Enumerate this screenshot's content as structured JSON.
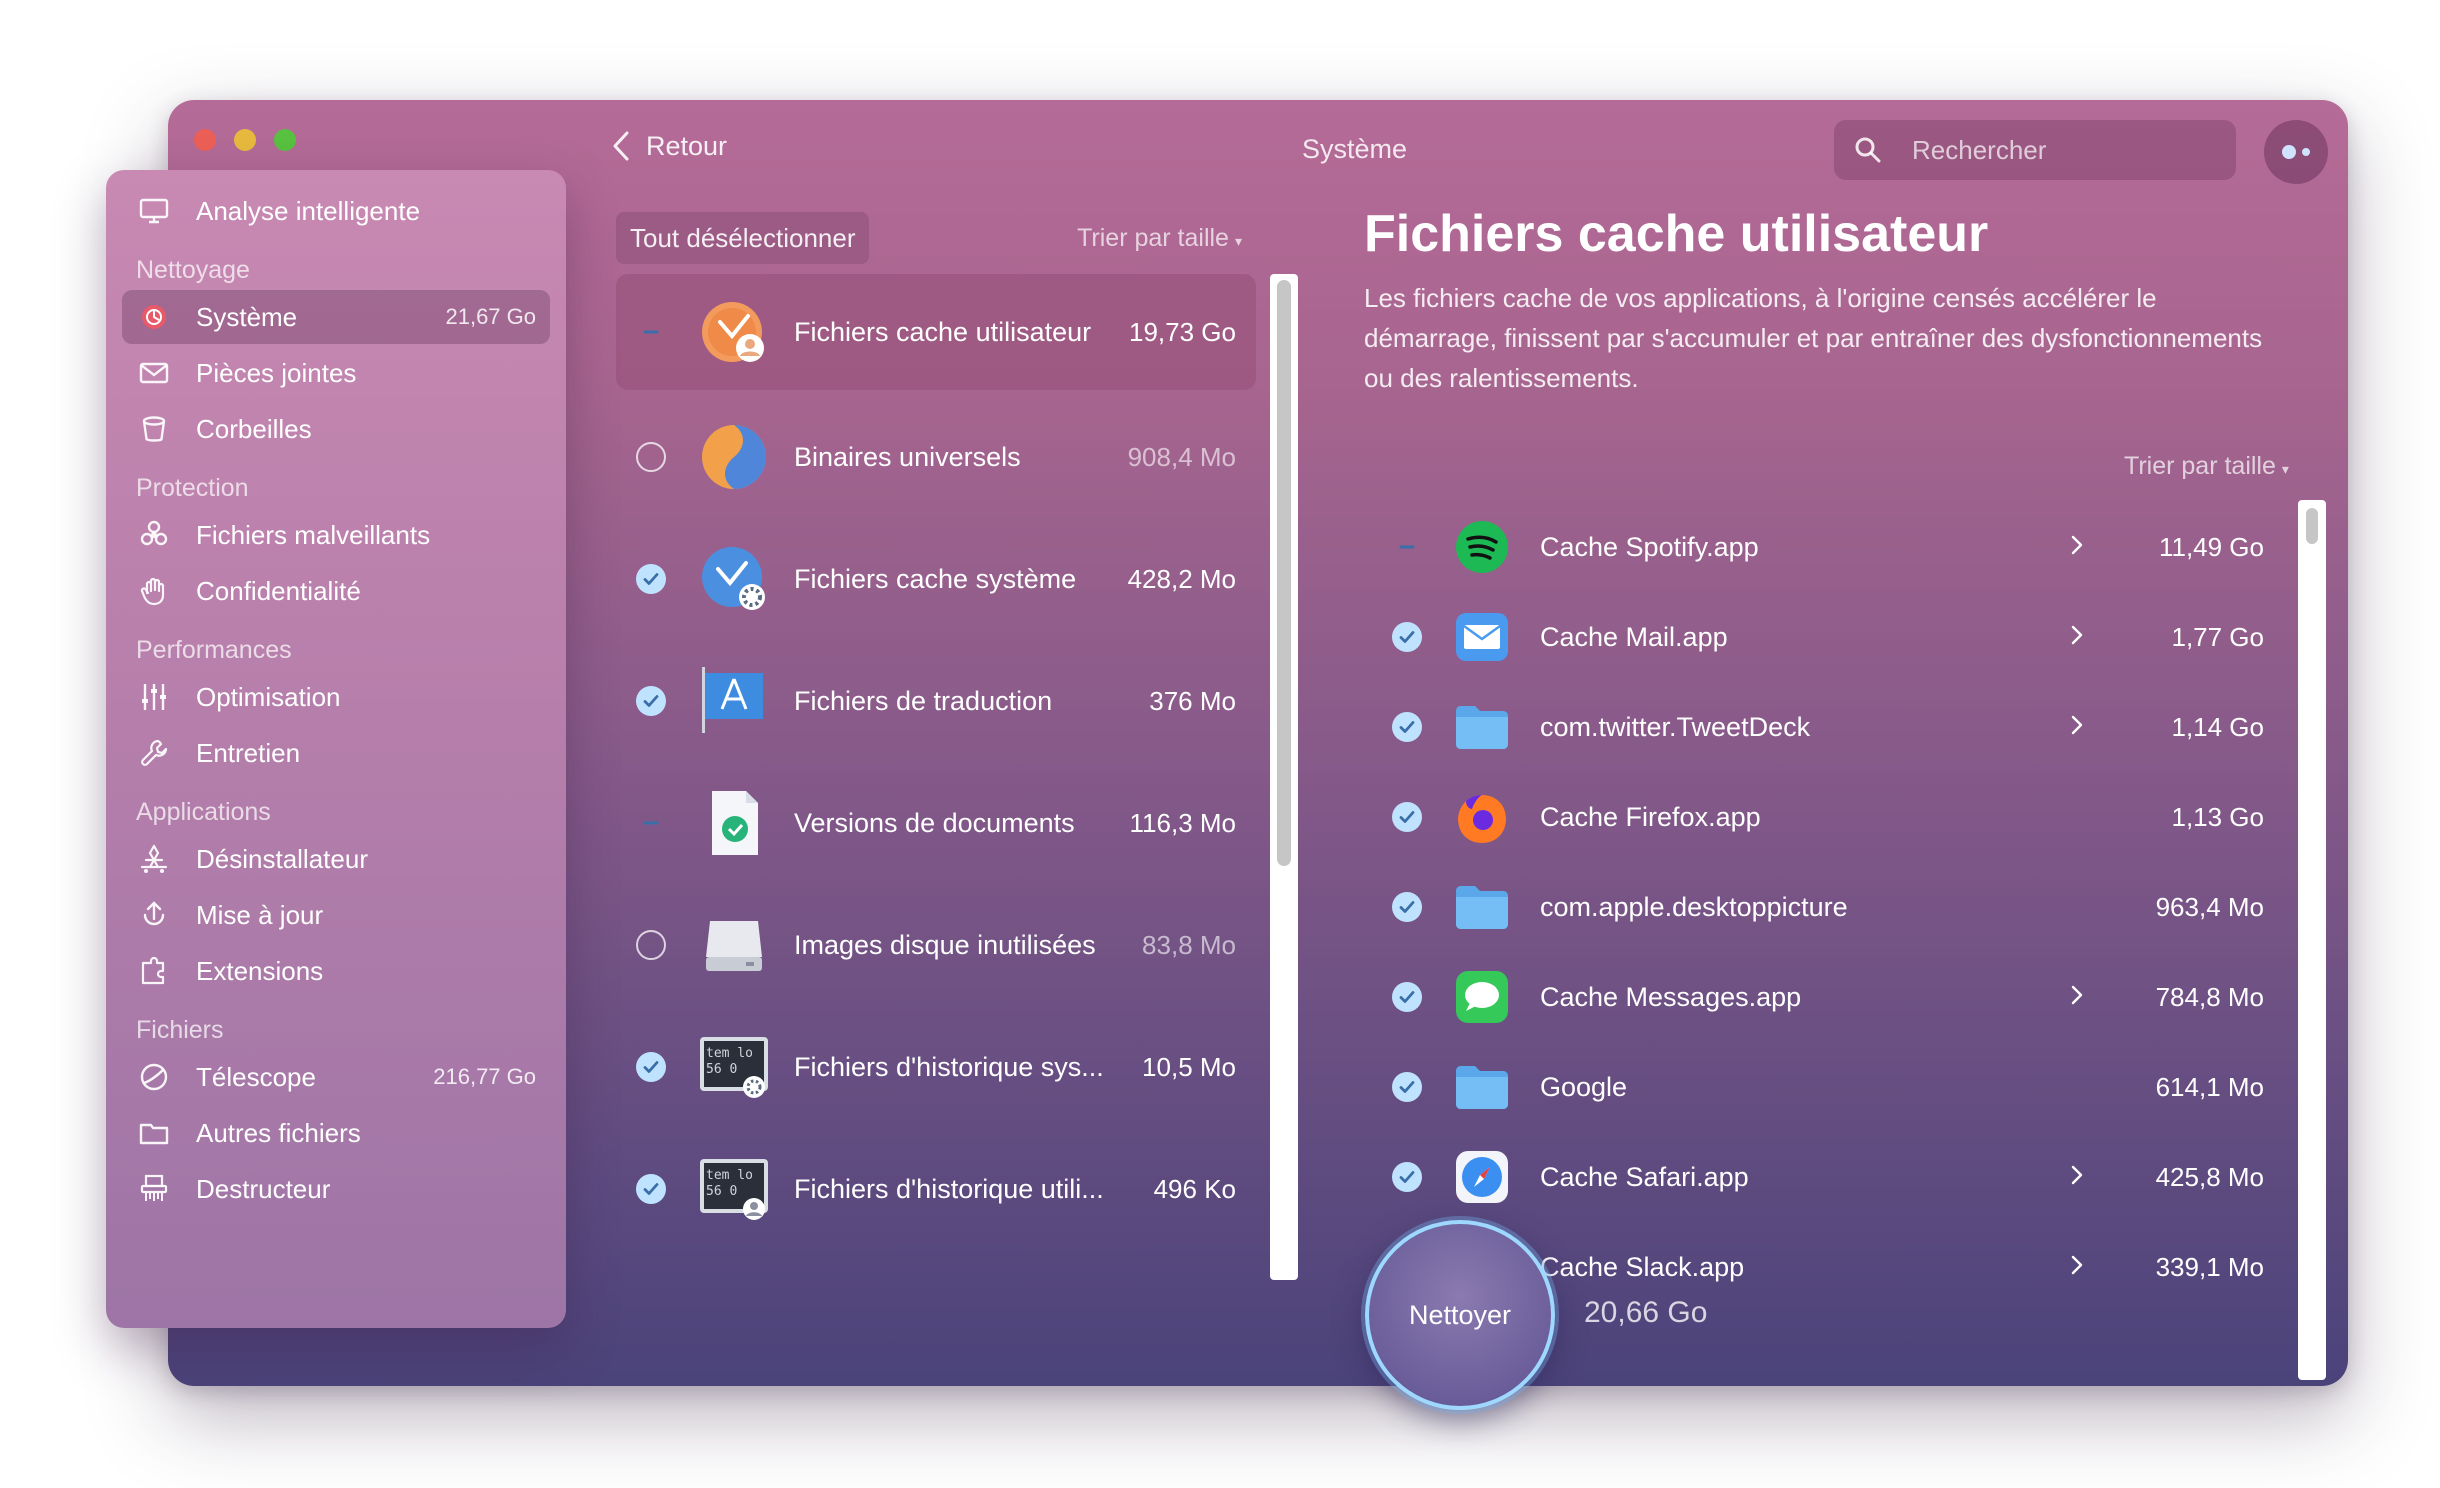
{
  "window": {
    "title": "Système",
    "back_label": "Retour"
  },
  "search": {
    "placeholder": "Rechercher"
  },
  "sidebar": {
    "top_item": {
      "label": "Analyse intelligente",
      "icon": "monitor-icon"
    },
    "sections": [
      {
        "title": "Nettoyage",
        "items": [
          {
            "label": "Système",
            "size": "21,67 Go",
            "icon": "system-junk-icon",
            "active": true
          },
          {
            "label": "Pièces jointes",
            "size": "",
            "icon": "envelope-icon"
          },
          {
            "label": "Corbeilles",
            "size": "",
            "icon": "trash-icon"
          }
        ]
      },
      {
        "title": "Protection",
        "items": [
          {
            "label": "Fichiers malveillants",
            "size": "",
            "icon": "biohazard-icon"
          },
          {
            "label": "Confidentialité",
            "size": "",
            "icon": "hand-icon"
          }
        ]
      },
      {
        "title": "Performances",
        "items": [
          {
            "label": "Optimisation",
            "size": "",
            "icon": "sliders-icon"
          },
          {
            "label": "Entretien",
            "size": "",
            "icon": "wrench-icon"
          }
        ]
      },
      {
        "title": "Applications",
        "items": [
          {
            "label": "Désinstallateur",
            "size": "",
            "icon": "uninstaller-icon"
          },
          {
            "label": "Mise à jour",
            "size": "",
            "icon": "update-icon"
          },
          {
            "label": "Extensions",
            "size": "",
            "icon": "extensions-icon"
          }
        ]
      },
      {
        "title": "Fichiers",
        "items": [
          {
            "label": "Télescope",
            "size": "216,77 Go",
            "icon": "space-lens-icon"
          },
          {
            "label": "Autres fichiers",
            "size": "",
            "icon": "folder-icon"
          },
          {
            "label": "Destructeur",
            "size": "",
            "icon": "shredder-icon"
          }
        ]
      }
    ]
  },
  "middle": {
    "deselect_label": "Tout désélectionner",
    "sort_label": "Trier par taille",
    "items": [
      {
        "name": "Fichiers cache utilisateur",
        "size": "19,73 Go",
        "state": "partial",
        "icon": "user-cache-icon",
        "active": true
      },
      {
        "name": "Binaires universels",
        "size": "908,4 Mo",
        "state": "off",
        "icon": "universal-binaries-icon"
      },
      {
        "name": "Fichiers cache système",
        "size": "428,2 Mo",
        "state": "on",
        "icon": "system-cache-icon"
      },
      {
        "name": "Fichiers de traduction",
        "size": "376 Mo",
        "state": "on",
        "icon": "language-files-icon"
      },
      {
        "name": "Versions de documents",
        "size": "116,3 Mo",
        "state": "partial",
        "icon": "document-versions-icon"
      },
      {
        "name": "Images disque inutilisées",
        "size": "83,8 Mo",
        "state": "off",
        "icon": "disk-image-icon"
      },
      {
        "name": "Fichiers d'historique sys...",
        "size": "10,5 Mo",
        "state": "on",
        "icon": "system-log-icon",
        "icon_text": [
          "tem lo",
          "56 0"
        ]
      },
      {
        "name": "Fichiers d'historique utili...",
        "size": "496 Ko",
        "state": "on",
        "icon": "user-log-icon",
        "icon_text": [
          "tem lo",
          "56 0"
        ]
      }
    ]
  },
  "detail": {
    "title": "Fichiers cache utilisateur",
    "description": "Les fichiers cache de vos applications, à l'origine censés accélérer le démarrage, finissent par s'accumuler et par entraîner des dysfonctionnements ou des ralentissements.",
    "sort_label": "Trier par taille",
    "items": [
      {
        "name": "Cache Spotify.app",
        "size": "11,49 Go",
        "state": "partial",
        "icon": "spotify-icon",
        "chevron": true
      },
      {
        "name": "Cache Mail.app",
        "size": "1,77 Go",
        "state": "on",
        "icon": "mail-icon",
        "chevron": true
      },
      {
        "name": "com.twitter.TweetDeck",
        "size": "1,14 Go",
        "state": "on",
        "icon": "folder-icon",
        "chevron": true
      },
      {
        "name": "Cache Firefox.app",
        "size": "1,13 Go",
        "state": "on",
        "icon": "firefox-icon",
        "chevron": false
      },
      {
        "name": "com.apple.desktoppicture",
        "size": "963,4 Mo",
        "state": "on",
        "icon": "folder-icon",
        "chevron": false
      },
      {
        "name": "Cache Messages.app",
        "size": "784,8 Mo",
        "state": "on",
        "icon": "messages-icon",
        "chevron": true
      },
      {
        "name": "Google",
        "size": "614,1 Mo",
        "state": "on",
        "icon": "folder-icon",
        "chevron": false
      },
      {
        "name": "Cache Safari.app",
        "size": "425,8 Mo",
        "state": "on",
        "icon": "safari-icon",
        "chevron": true
      },
      {
        "name": "Cache Slack.app",
        "size": "339,1 Mo",
        "state": "on",
        "icon": "slack-icon",
        "chevron": true
      }
    ]
  },
  "footer": {
    "clean_label": "Nettoyer",
    "total": "20,66 Go"
  },
  "colors": {
    "check_fill": "#bfe3ff",
    "check_mark": "#3a6ea8",
    "accent_ring": "#9fd8ff"
  }
}
